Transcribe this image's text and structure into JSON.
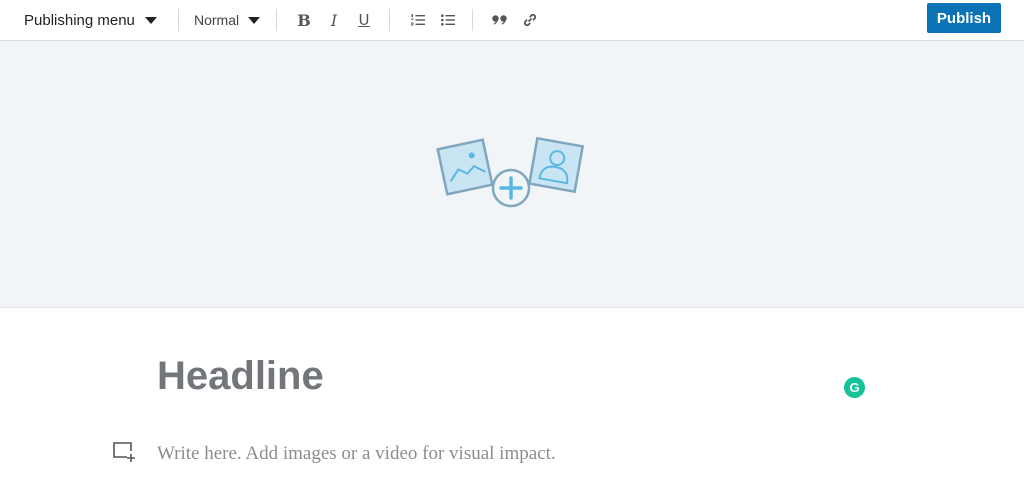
{
  "toolbar": {
    "publishing_menu_label": "Publishing menu",
    "text_style_label": "Normal",
    "publish_label": "Publish",
    "icons": [
      "caret-down-icon",
      "bold-icon",
      "italic-icon",
      "underline-icon",
      "numbered-list-icon",
      "bulleted-list-icon",
      "quote-icon",
      "link-icon"
    ],
    "glyphs": {
      "bold": "B",
      "italic": "I",
      "underline": "U"
    }
  },
  "cover": {
    "icon": "add-cover-image-icon"
  },
  "editor": {
    "headline_placeholder": "Headline",
    "body_placeholder": "Write here. Add images or a video for visual impact.",
    "add_media_icon": "add-media-icon",
    "grammarly_icon": "grammarly-icon",
    "grammarly_glyph": "G"
  },
  "colors": {
    "publish_button": "#0a73b5",
    "cover_background": "#f2f5f8",
    "illustration_stroke": "#7fa7bf",
    "illustration_fill": "#c9e5f4",
    "illustration_accent": "#58b8e2",
    "grammarly": "#15c39a",
    "headline_text": "#72767a",
    "body_placeholder_text": "#8a8d90"
  }
}
